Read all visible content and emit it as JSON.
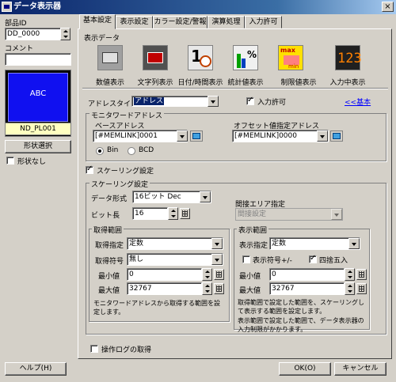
{
  "window": {
    "title": "データ表示器",
    "close": "×"
  },
  "left": {
    "part_id_label": "部品ID",
    "part_id_value": "DD_0000",
    "comment_label": "コメント",
    "comment_value": "",
    "preview_text": "ABC",
    "preview_name": "ND_PL001",
    "shape_select": "形状選択",
    "no_shape": "形状なし"
  },
  "tabs": [
    "基本設定",
    "表示設定",
    "カラー設定/警報",
    "演算処理",
    "入力許可"
  ],
  "display_data": {
    "label": "表示データ",
    "items": [
      "数値表示",
      "文字列表示",
      "日付/時間表示",
      "統計値表示",
      "制限値表示",
      "入力中表示"
    ]
  },
  "address": {
    "type_label": "アドレスタイプ",
    "type_value": "アドレス",
    "input_allow": "入力許可",
    "link": "<<基本"
  },
  "monitor": {
    "group": "モニタワードアドレス",
    "base_label": "ベースアドレス",
    "base_value": "[#MEMLINK]0001",
    "offset_label": "オフセット値指定アドレス",
    "offset_value": "[#MEMLINK]0000",
    "bin": "Bin",
    "bcd": "BCD"
  },
  "scaling": {
    "checkbox": "スケーリング設定",
    "group": "スケーリング設定",
    "format_label": "データ形式",
    "format_value": "16ビット Dec",
    "bitlen_label": "ビット長",
    "bitlen_value": "16",
    "indirect_label": "間接エリア指定",
    "indirect_value": "間接設定"
  },
  "source": {
    "group": "取得範囲",
    "spec_label": "取得指定",
    "spec_value": "定数",
    "sign_label": "取得符号",
    "sign_value": "無し",
    "min_label": "最小値",
    "min_value": "0",
    "max_label": "最大値",
    "max_value": "32767",
    "note": "モニタワードアドレスから取得する範囲を設定します。"
  },
  "display": {
    "group": "表示範囲",
    "spec_label": "表示指定",
    "spec_value": "定数",
    "sign_chk": "表示符号+/-",
    "round_chk": "四捨五入",
    "min_label": "最小値",
    "min_value": "0",
    "max_label": "最大値",
    "max_value": "32767",
    "note1": "取得範囲で設定した範囲を、スケーリングして表示する範囲を設定します。",
    "note2": "表示範囲で設定した範囲で、データ表示器の入力制限がかかります。"
  },
  "oplog": "操作ログの取得",
  "buttons": {
    "help": "ヘルプ(H)",
    "ok": "OK(O)",
    "cancel": "キャンセル"
  }
}
